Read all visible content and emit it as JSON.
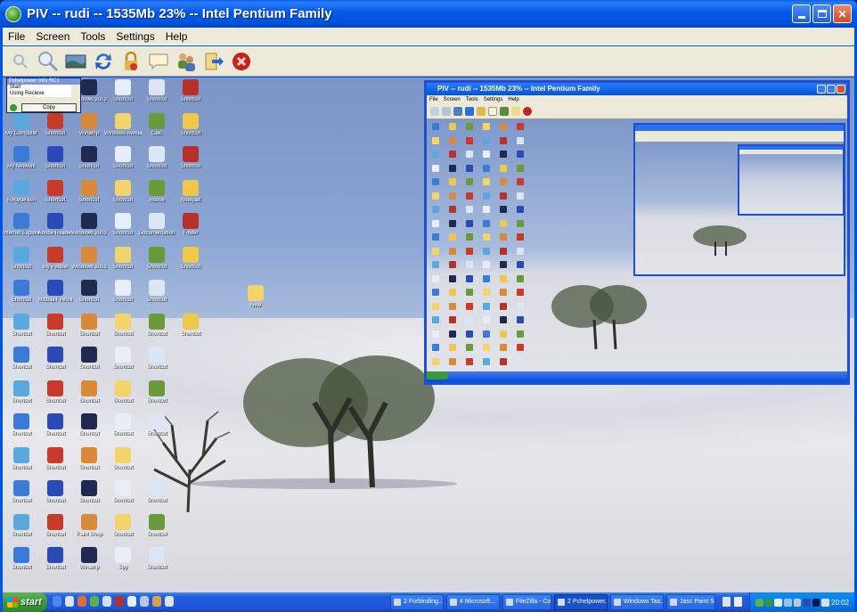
{
  "window": {
    "title": "PIV -- rudi -- 1535Mb 23% -- Intel Pentium Family",
    "controls": {
      "minimize": "minimize",
      "maximize": "maximize",
      "close": "close"
    }
  },
  "menu": [
    "File",
    "Screen",
    "Tools",
    "Settings",
    "Help"
  ],
  "toolbar": [
    {
      "name": "zoom-out",
      "icon": "magnifier-small-icon"
    },
    {
      "name": "zoom-in",
      "icon": "magnifier-large-icon"
    },
    {
      "name": "fit-screen",
      "icon": "landscape-picture-icon"
    },
    {
      "name": "refresh",
      "icon": "refresh-arrows-icon"
    },
    {
      "name": "lock",
      "icon": "padlock-icon"
    },
    {
      "name": "chat",
      "icon": "speech-bubble-icon"
    },
    {
      "name": "users",
      "icon": "users-icon"
    },
    {
      "name": "transfer",
      "icon": "file-transfer-icon"
    },
    {
      "name": "disconnect",
      "icon": "red-x-close-icon"
    }
  ],
  "popup": {
    "title": "Pchelpower Info RC1",
    "lines": [
      "Start",
      "Using Recieve"
    ],
    "button": "Copy"
  },
  "desktop_icons": [
    "Internet Explorer",
    "Adobe Reader",
    "Windows 2003",
    "Shortcut",
    "Shortcut",
    "Shortcut",
    "My Computer",
    "Shortcut",
    "Winamp",
    "Windows Media",
    "Calc",
    "Shortcut",
    "My Network",
    "Shortcut",
    "Shortcut",
    "Shortcut",
    "Shortcut",
    "Shortcut",
    "Recycle Bin",
    "Shortcut",
    "Shortcut",
    "Shortcut",
    "Adobe",
    "Notepad",
    "Internet Explorer",
    "Adobe Reader",
    "Windows 2003",
    "Shortcut",
    "Documentation",
    "Folder",
    "Shortcut",
    "My People",
    "Windows 2003",
    "Shortcut",
    "Shortcut",
    "Shortcut",
    "Shortcut",
    "Mozilla Firefox",
    "Shortcut",
    "Shortcut",
    "Shortcut",
    "",
    "Shortcut",
    "Shortcut",
    "Shortcut",
    "Shortcut",
    "Shortcut",
    "Shortcut",
    "Shortcut",
    "Shortcut",
    "Shortcut",
    "Shortcut",
    "Shortcut",
    "",
    "Shortcut",
    "Shortcut",
    "Shortcut",
    "Shortcut",
    "Shortcut",
    "",
    "Shortcut",
    "Shortcut",
    "Shortcut",
    "Shortcut",
    "Shortcut",
    "",
    "Shortcut",
    "Shortcut",
    "Shortcut",
    "Shortcut",
    "",
    "",
    "Shortcut",
    "Shortcut",
    "Shortcut",
    "Shortcut",
    "Shortcut",
    "",
    "Shortcut",
    "Shortcut",
    "Paint Shop",
    "Shortcut",
    "Shortcut",
    "",
    "Shortcut",
    "Shortcut",
    "Winamp",
    "Spy",
    "Shortcut",
    ""
  ],
  "desktop_folder_label": "New",
  "inner_window": {
    "title": "PIV -- rudi -- 1535Mb 23% -- Intel Pentium Family",
    "menu": [
      "File",
      "Screen",
      "Tools",
      "Settings",
      "Help"
    ]
  },
  "taskbar": {
    "start": "start",
    "tasks": [
      {
        "label": "2 Forbinding...",
        "active": false
      },
      {
        "label": "4 Microsoft...",
        "active": false
      },
      {
        "label": "FileZilla - Con...",
        "active": false
      },
      {
        "label": "2 Pchelpower...",
        "active": true
      },
      {
        "label": "Windows Tas...",
        "active": false
      },
      {
        "label": "Jasc Paint Sh...",
        "active": false
      }
    ],
    "clock": "20:02"
  }
}
